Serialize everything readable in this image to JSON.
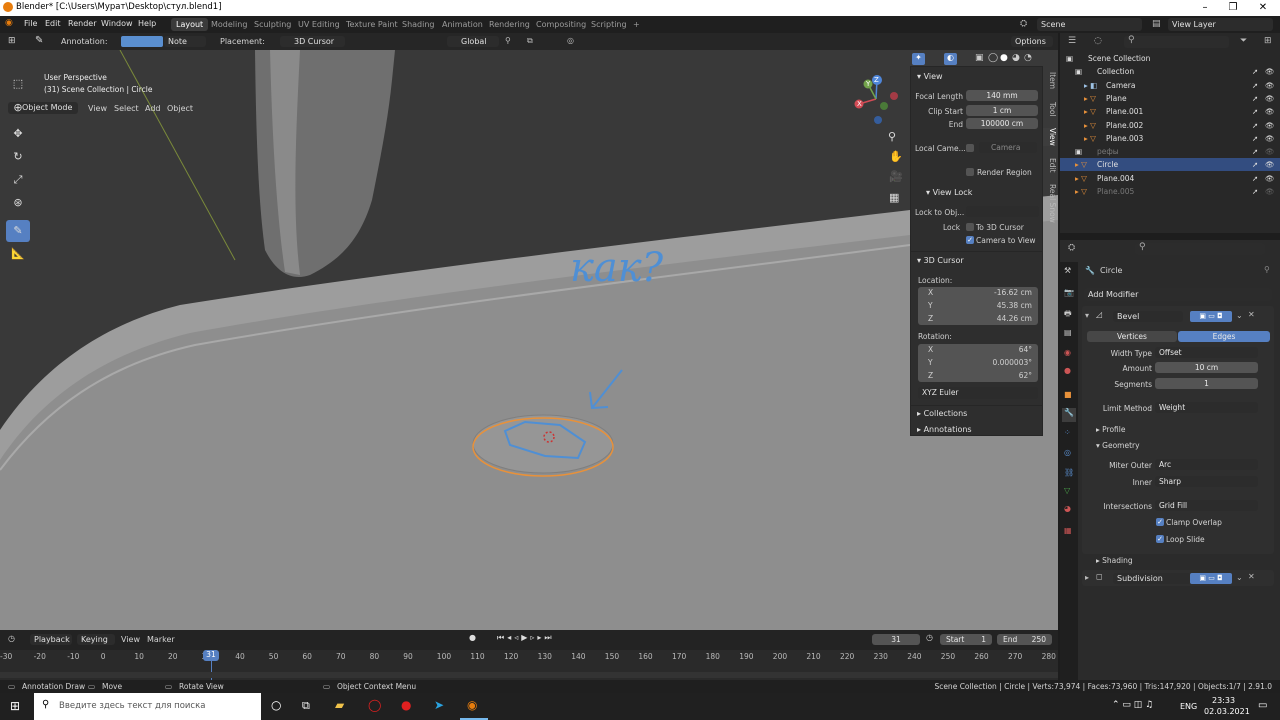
{
  "window": {
    "title": "Blender* [C:\\Users\\Мурат\\Desktop\\стул.blend1]",
    "minimize": "–",
    "maximize": "❐",
    "close": "✕"
  },
  "menu": [
    "File",
    "Edit",
    "Render",
    "Window",
    "Help"
  ],
  "workspaces": [
    "Layout",
    "Modeling",
    "Sculpting",
    "UV Editing",
    "Texture Paint",
    "Shading",
    "Animation",
    "Rendering",
    "Compositing",
    "Scripting"
  ],
  "workspace_add": "+",
  "scene": {
    "name": "Scene",
    "view_layer": "View Layer"
  },
  "tool_header": {
    "annotation_label": "Annotation:",
    "annotation_color": "#5a8fd0",
    "note": "Note",
    "placement_label": "Placement:",
    "placement_value": "3D Cursor",
    "orientation": "Global",
    "options": "Options"
  },
  "vp_header": {
    "mode": "Object Mode",
    "menus": [
      "View",
      "Select",
      "Add",
      "Object"
    ]
  },
  "viewport": {
    "perspective": "User Perspective",
    "info": "(31) Scene Collection | Circle",
    "handwriting": "как?",
    "gizmo": {
      "z": "Z",
      "y": "Y",
      "x": "X"
    }
  },
  "npanel": {
    "view_header": "View",
    "focal_length_label": "Focal Length",
    "focal_length": "140 mm",
    "clip_start_label": "Clip Start",
    "clip_start": "1 cm",
    "end_label": "End",
    "end": "100000 cm",
    "local_camera_label": "Local Came...",
    "local_camera": "Camera",
    "render_region": "Render Region",
    "view_lock_header": "View Lock",
    "lock_to_obj_label": "Lock to Obj...",
    "lock_label": "Lock",
    "to_3d_cursor": "To 3D Cursor",
    "camera_to_view": "Camera to View",
    "cursor_header": "3D Cursor",
    "location_label": "Location:",
    "loc": [
      {
        "axis": "X",
        "value": "-16.62 cm"
      },
      {
        "axis": "Y",
        "value": "45.38 cm"
      },
      {
        "axis": "Z",
        "value": "44.26 cm"
      }
    ],
    "rotation_label": "Rotation:",
    "rot": [
      {
        "axis": "X",
        "value": "64°"
      },
      {
        "axis": "Y",
        "value": "0.000003°"
      },
      {
        "axis": "Z",
        "value": "62°"
      }
    ],
    "rotation_mode": "XYZ Euler",
    "collections": "Collections",
    "annotations": "Annotations"
  },
  "ntabs": [
    "Item",
    "Tool",
    "View",
    "Edit",
    "Real Snow"
  ],
  "outliner": {
    "search_placeholder": "",
    "items": [
      {
        "name": "Scene Collection",
        "indent": 0,
        "type": "scene"
      },
      {
        "name": "Collection",
        "indent": 1,
        "type": "collection"
      },
      {
        "name": "Camera",
        "indent": 2,
        "type": "camera"
      },
      {
        "name": "Plane",
        "indent": 2,
        "type": "mesh"
      },
      {
        "name": "Plane.001",
        "indent": 2,
        "type": "mesh"
      },
      {
        "name": "Plane.002",
        "indent": 2,
        "type": "mesh"
      },
      {
        "name": "Plane.003",
        "indent": 2,
        "type": "mesh"
      },
      {
        "name": "рефы",
        "indent": 1,
        "type": "collection-dim"
      },
      {
        "name": "Circle",
        "indent": 1,
        "type": "selected"
      },
      {
        "name": "Plane.004",
        "indent": 1,
        "type": "mesh"
      },
      {
        "name": "Plane.005",
        "indent": 1,
        "type": "dim"
      }
    ]
  },
  "properties": {
    "object": "Circle",
    "add_modifier": "Add Modifier",
    "bevel": {
      "name": "Bevel",
      "tab_vertices": "Vertices",
      "tab_edges": "Edges",
      "width_type_label": "Width Type",
      "width_type": "Offset",
      "amount_label": "Amount",
      "amount": "10 cm",
      "segments_label": "Segments",
      "segments": "1",
      "limit_method_label": "Limit Method",
      "limit_method": "Weight",
      "profile": "Profile",
      "geometry": "Geometry",
      "miter_outer_label": "Miter Outer",
      "miter_outer": "Arc",
      "inner_label": "Inner",
      "inner": "Sharp",
      "intersections_label": "Intersections",
      "intersections": "Grid Fill",
      "clamp_overlap": "Clamp Overlap",
      "loop_slide": "Loop Slide",
      "shading": "Shading"
    },
    "subdivision": "Subdivision"
  },
  "timeline": {
    "playback": "Playback",
    "keying": "Keying",
    "view": "View",
    "marker": "Marker",
    "current_frame": "31",
    "start_label": "Start",
    "start": "1",
    "end_label": "End",
    "end": "250",
    "ruler": [
      "-30",
      "-20",
      "-10",
      "0",
      "10",
      "20",
      "30",
      "40",
      "50",
      "60",
      "70",
      "80",
      "90",
      "100",
      "110",
      "120",
      "130",
      "140",
      "150",
      "160",
      "170",
      "180",
      "190",
      "200",
      "210",
      "220",
      "230",
      "240",
      "250",
      "260",
      "270",
      "280"
    ]
  },
  "status": {
    "left1": "Annotation Draw",
    "left2": "Move",
    "left3": "Rotate View",
    "mid": "Object Context Menu",
    "right": "Scene Collection | Circle | Verts:73,974 | Faces:73,960 | Tris:147,920 | Objects:1/7 | 2.91.0"
  },
  "taskbar": {
    "search_placeholder": "Введите здесь текст для поиска",
    "lang": "ENG",
    "time": "23:33",
    "date": "02.03.2021"
  }
}
